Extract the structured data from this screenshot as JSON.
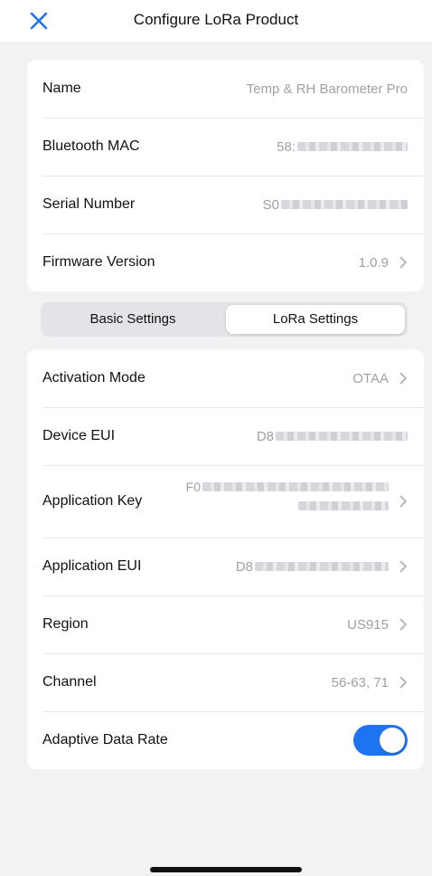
{
  "header": {
    "title": "Configure LoRa Product"
  },
  "info": {
    "name": {
      "label": "Name",
      "value": "Temp & RH Barometer Pro"
    },
    "bluetooth_mac": {
      "label": "Bluetooth MAC",
      "value": "58:"
    },
    "serial_number": {
      "label": "Serial Number",
      "value": "S0"
    },
    "firmware_version": {
      "label": "Firmware Version",
      "value": "1.0.9"
    }
  },
  "tabs": {
    "basic": "Basic Settings",
    "lora": "LoRa Settings",
    "selected": "LoRa Settings"
  },
  "lora": {
    "activation_mode": {
      "label": "Activation Mode",
      "value": "OTAA"
    },
    "device_eui": {
      "label": "Device EUI",
      "value": "D8"
    },
    "application_key": {
      "label": "Application Key",
      "value": "F0"
    },
    "application_eui": {
      "label": "Application EUI",
      "value": "D8"
    },
    "region": {
      "label": "Region",
      "value": "US915"
    },
    "channel": {
      "label": "Channel",
      "value": "56-63, 71"
    },
    "adaptive_data_rate": {
      "label": "Adaptive Data Rate",
      "enabled": true
    }
  },
  "colors": {
    "accent": "#1e74f0",
    "background": "#f2f2f4",
    "value_text": "#a0a0a6"
  },
  "icons": {
    "close": "close-icon",
    "chevron": "chevron-right-icon"
  }
}
